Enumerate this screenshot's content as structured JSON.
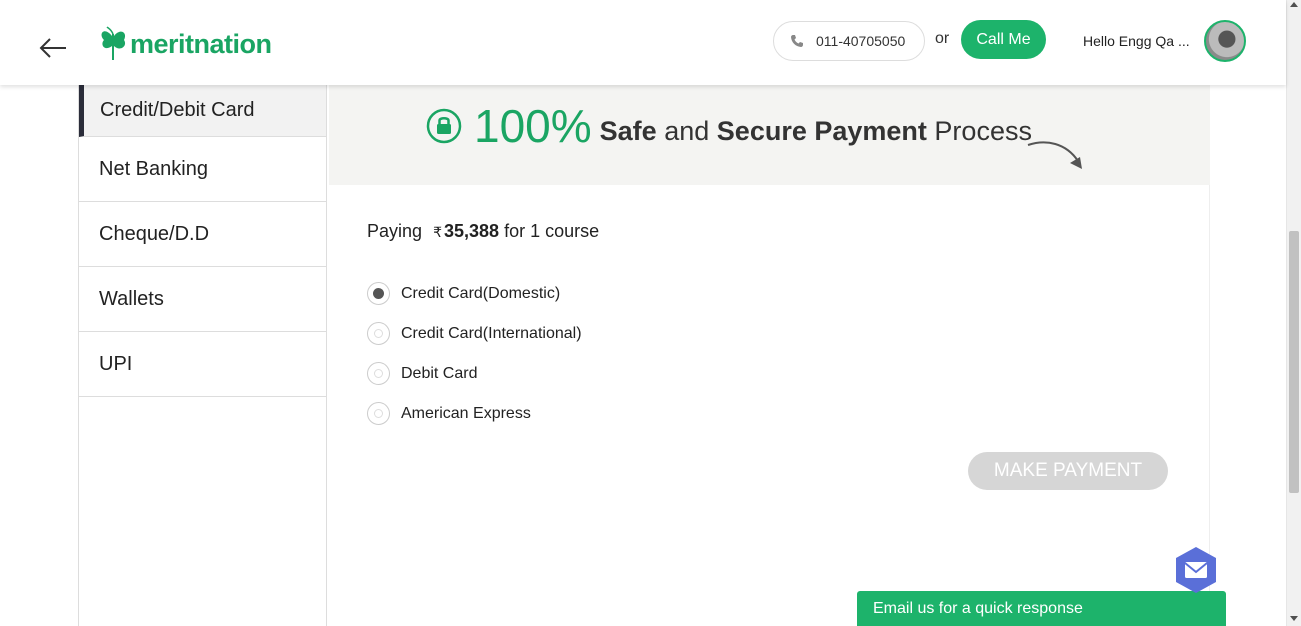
{
  "header": {
    "logo_text": "meritnation",
    "phone_number": "011-40705050",
    "or_text": "or",
    "call_me_label": "Call Me",
    "greeting": "Hello Engg Qa ..."
  },
  "sidebar": {
    "items": [
      {
        "label": "Credit/Debit Card",
        "active": true
      },
      {
        "label": "Net Banking",
        "active": false
      },
      {
        "label": "Cheque/D.D",
        "active": false
      },
      {
        "label": "Wallets",
        "active": false
      },
      {
        "label": "UPI",
        "active": false
      }
    ]
  },
  "banner": {
    "percent": "100%",
    "safe": "Safe",
    "and": "and",
    "secure_payment": "Secure Payment",
    "process": "Process"
  },
  "payment": {
    "paying_label": "Paying",
    "currency_symbol": "₹",
    "amount": "35,388",
    "for_text": "for 1 course",
    "options": [
      {
        "label": "Credit Card(Domestic)",
        "selected": true
      },
      {
        "label": "Credit Card(International)",
        "selected": false
      },
      {
        "label": "Debit Card",
        "selected": false
      },
      {
        "label": "American Express",
        "selected": false
      }
    ],
    "make_payment_label": "MAKE PAYMENT"
  },
  "email_widget": {
    "label": "Email us for a quick response"
  },
  "colors": {
    "brand_green": "#1db36b",
    "active_marker": "#2b2d3a",
    "disabled_button": "#d6d6d6"
  }
}
